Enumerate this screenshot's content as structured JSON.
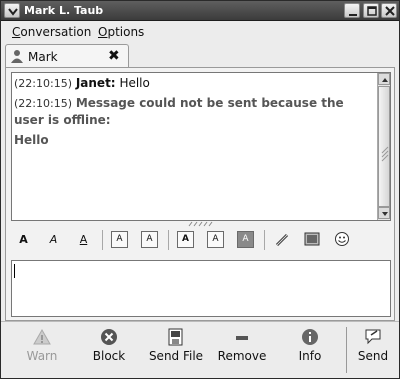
{
  "window": {
    "title": "Mark L. Taub"
  },
  "menubar": {
    "items": [
      {
        "mnemonic": "C",
        "rest": "onversation"
      },
      {
        "mnemonic": "O",
        "rest": "ptions"
      }
    ]
  },
  "tab": {
    "label": "Mark",
    "close_glyph": "✖"
  },
  "conversation": {
    "messages": [
      {
        "time": "(22:10:15)",
        "sender": "Janet:",
        "text": "Hello"
      },
      {
        "time": "(22:10:15)",
        "text": "Message could not be sent because the user is offline:"
      }
    ],
    "echo": "Hello"
  },
  "format_toolbar": {
    "bold": "A",
    "italic": "A",
    "underline": "A",
    "larger": "A",
    "smaller": "A",
    "font_face": "A",
    "fg_color": "A",
    "bg_color": "A"
  },
  "input": {
    "value": ""
  },
  "actions": {
    "warn": "Warn",
    "block": "Block",
    "send_file": "Send File",
    "remove": "Remove",
    "info": "Info",
    "send": "Send"
  }
}
